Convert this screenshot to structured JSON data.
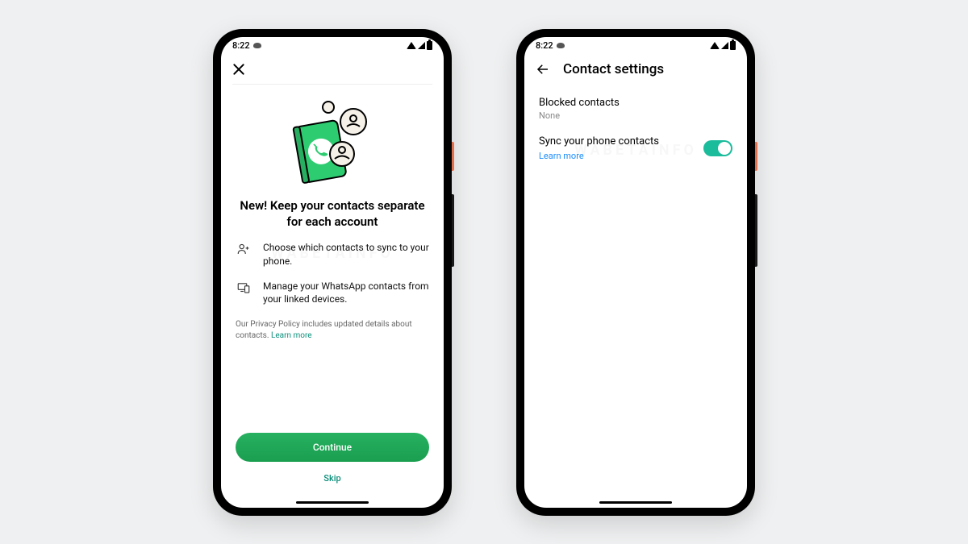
{
  "statusBar": {
    "time": "8:22"
  },
  "screen1": {
    "headline": "New! Keep your contacts separate for each account",
    "feature1": "Choose which contacts to sync to your phone.",
    "feature2": "Manage your WhatsApp contacts from your linked devices.",
    "policyText": "Our Privacy Policy includes updated details about contacts. ",
    "policyLink": "Learn more",
    "continueLabel": "Continue",
    "skipLabel": "Skip"
  },
  "screen2": {
    "title": "Contact settings",
    "blockedLabel": "Blocked contacts",
    "blockedValue": "None",
    "syncLabel": "Sync your phone contacts",
    "learnMore": "Learn more",
    "syncEnabled": true
  },
  "colors": {
    "primaryGreen": "#1fa855",
    "accentTeal": "#0a8f7a",
    "toggleOn": "#1abc9c",
    "linkBlue": "#1a8cff"
  }
}
